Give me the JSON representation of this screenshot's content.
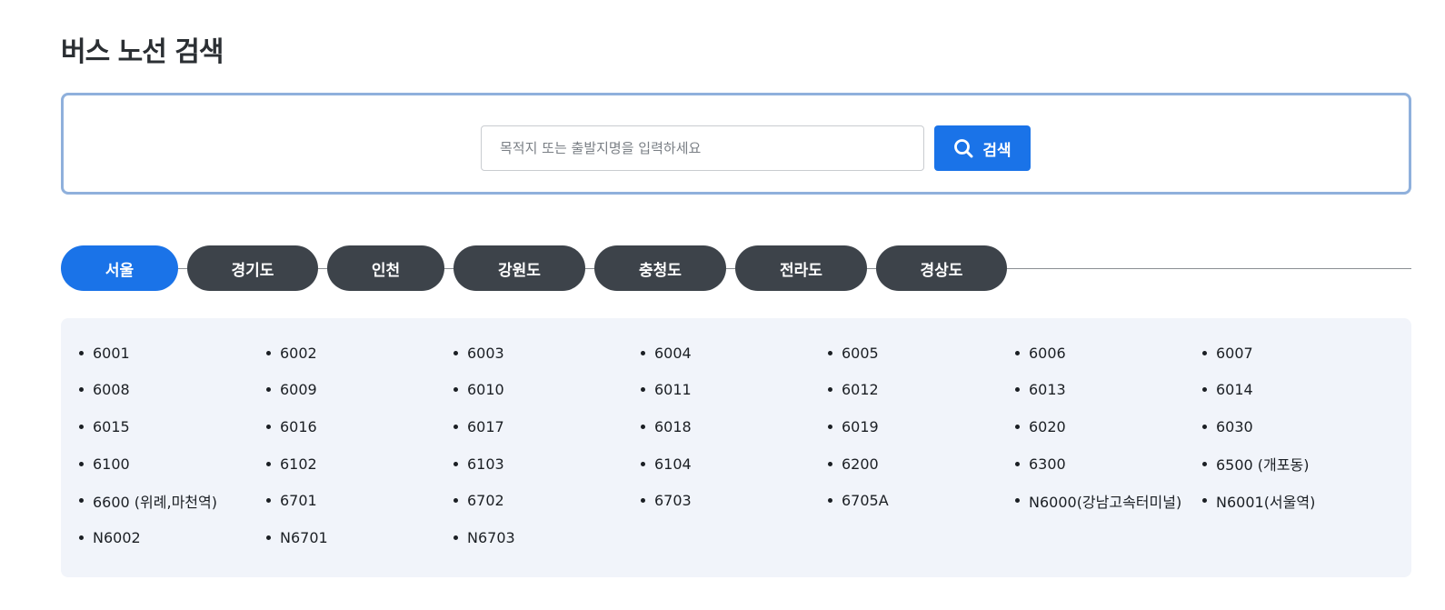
{
  "page": {
    "title": "버스 노선 검색"
  },
  "search": {
    "placeholder": "목적지 또는 출발지명을 입력하세요",
    "value": "",
    "button_label": "검색",
    "button_icon": "search-icon"
  },
  "tabs": [
    {
      "label": "서울",
      "active": true
    },
    {
      "label": "경기도",
      "active": false
    },
    {
      "label": "인천",
      "active": false
    },
    {
      "label": "강원도",
      "active": false
    },
    {
      "label": "충청도",
      "active": false
    },
    {
      "label": "전라도",
      "active": false
    },
    {
      "label": "경상도",
      "active": false
    }
  ],
  "routes": [
    "6001",
    "6002",
    "6003",
    "6004",
    "6005",
    "6006",
    "6007",
    "6008",
    "6009",
    "6010",
    "6011",
    "6012",
    "6013",
    "6014",
    "6015",
    "6016",
    "6017",
    "6018",
    "6019",
    "6020",
    "6030",
    "6100",
    "6102",
    "6103",
    "6104",
    "6200",
    "6300",
    "6500 (개포동)",
    "6600 (위례,마천역)",
    "6701",
    "6702",
    "6703",
    "6705A",
    "N6000(강남고속터미널)",
    "N6001(서울역)",
    "N6002",
    "N6701",
    "N6703"
  ],
  "colors": {
    "accent": "#1a73e8",
    "tab_inactive": "#3d434a",
    "panel_border": "#8fb0dc",
    "list_background": "#f1f4fa"
  }
}
